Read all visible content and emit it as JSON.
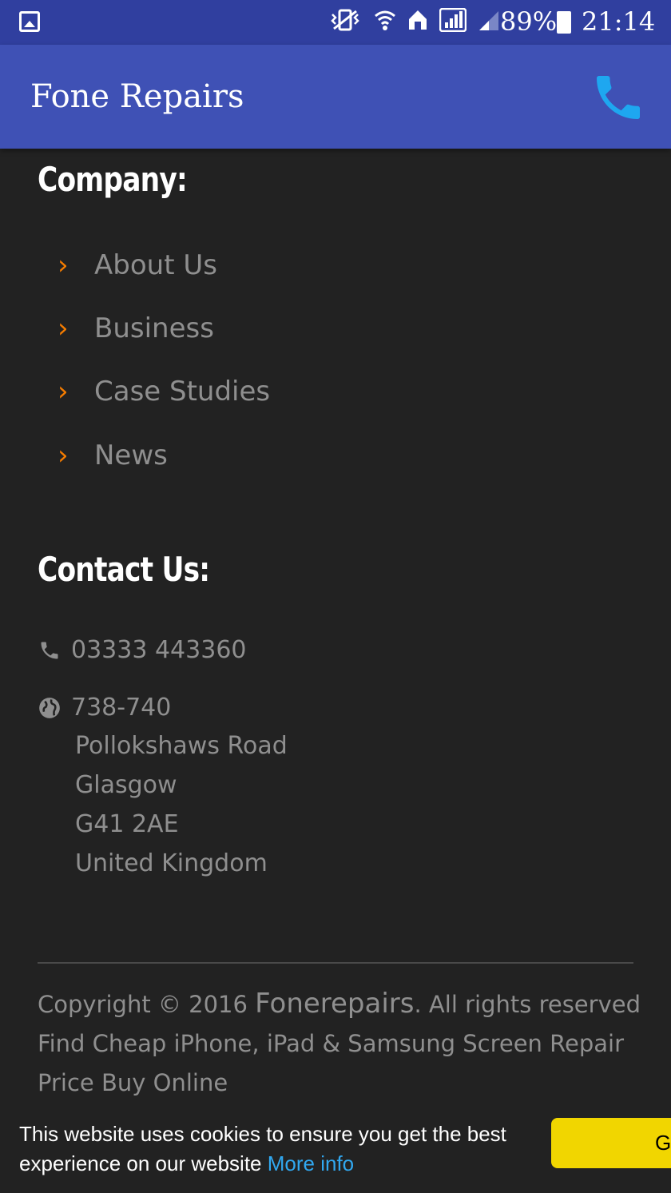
{
  "status_bar": {
    "battery_percent": "89%",
    "time": "21:14"
  },
  "app_bar": {
    "title": "Fone Repairs",
    "phone_icon_color": "#1EA7F0"
  },
  "company": {
    "heading": "Company:",
    "links": [
      {
        "label": "About Us"
      },
      {
        "label": "Business"
      },
      {
        "label": "Case Studies"
      },
      {
        "label": "News"
      }
    ]
  },
  "contact": {
    "heading": "Contact Us:",
    "phone": "03333 443360",
    "address": [
      "738-740",
      "Pollokshaws Road",
      "Glasgow",
      "G41 2AE",
      "United Kingdom"
    ]
  },
  "footer": {
    "copyright_prefix": "Copyright © 2016 ",
    "brand": "Fonerepairs",
    "copyright_suffix": ". All rights reserved",
    "tagline": "Find Cheap iPhone, iPad & Samsung Screen Repair Price Buy Online"
  },
  "cookie_banner": {
    "message": "This website uses cookies to ensure you get the best experience on our website ",
    "more_info": "More info",
    "button_label": "Got it!"
  },
  "colors": {
    "status_bar": "#303F9F",
    "app_bar": "#3F51B5",
    "background": "#222222",
    "chevron": "#F57C00",
    "cookie_button": "#F1D600",
    "link_blue": "#31A8F0"
  }
}
